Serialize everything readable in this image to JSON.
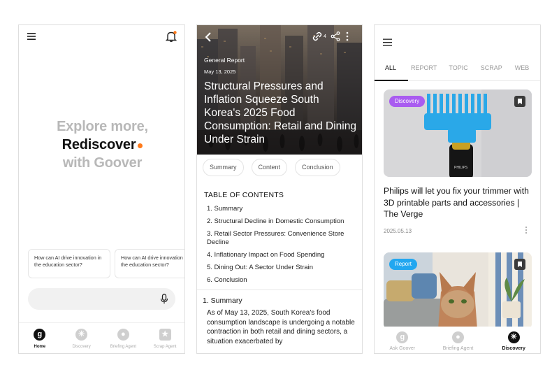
{
  "home": {
    "hero": {
      "line1": "Explore more,",
      "line2": "Rediscover",
      "line3": "with Goover"
    },
    "suggestions": [
      "How can AI drive innovation in the education sector?",
      "How can AI drive innovation in the education sector?"
    ],
    "search": {
      "placeholder": ""
    },
    "tabs": [
      {
        "label": "Home",
        "icon": "goover-logo-icon",
        "glyph": "g",
        "active": true
      },
      {
        "label": "Discovery",
        "icon": "discovery-icon",
        "glyph": "✳",
        "active": false
      },
      {
        "label": "Briefing Agent",
        "icon": "lightbulb-icon",
        "glyph": "●",
        "active": false
      },
      {
        "label": "Scrap Agent",
        "icon": "scrap-icon",
        "glyph": "★",
        "active": false
      }
    ]
  },
  "report": {
    "share_count": "4",
    "category": "General Report",
    "date": "May 13, 2025",
    "title": "Structural Pressures and Inflation Squeeze South Korea's 2025 Food Consumption: Retail and Dining Under Strain",
    "chips": [
      "Summary",
      "Content",
      "Conclusion"
    ],
    "toc_heading": "TABLE OF CONTENTS",
    "toc": [
      "1. Summary",
      "2. Structural Decline in Domestic Consumption",
      "3. Retail Sector Pressures: Convenience Store Decline",
      "4. Inflationary Impact on Food Spending",
      "5. Dining Out: A Sector Under Strain",
      "6. Conclusion"
    ],
    "section_title": "1. Summary",
    "section_body": "As of May 13, 2025, South Korea's food consumption landscape is undergoing a notable contraction in both retail and dining sectors, a situation exacerbated by"
  },
  "discovery": {
    "tabs": [
      "ALL",
      "REPORT",
      "TOPIC",
      "SCRAP",
      "WEB"
    ],
    "active_tab": "ALL",
    "cards": [
      {
        "badge": "Discovery",
        "badge_color": "#a95cf0",
        "product_text": "PHILIPS",
        "title": "Philips will let you fix your trimmer with 3D printable parts and accessories | The Verge",
        "date": "2025.05.13"
      },
      {
        "badge": "Report",
        "badge_color": "#22a7f0"
      }
    ],
    "tabbar": [
      {
        "label": "Ask Goover",
        "icon": "goover-logo-icon",
        "glyph": "g",
        "active": false
      },
      {
        "label": "Briefing Agent",
        "icon": "lightbulb-icon",
        "glyph": "●",
        "active": false
      },
      {
        "label": "Discovery",
        "icon": "discovery-icon",
        "glyph": "✳",
        "active": true
      }
    ]
  },
  "colors": {
    "accent_orange": "#ff7a1a",
    "discovery_badge": "#a95cf0",
    "report_badge": "#22a7f0",
    "trimmer_blue": "#2aa8e8"
  }
}
